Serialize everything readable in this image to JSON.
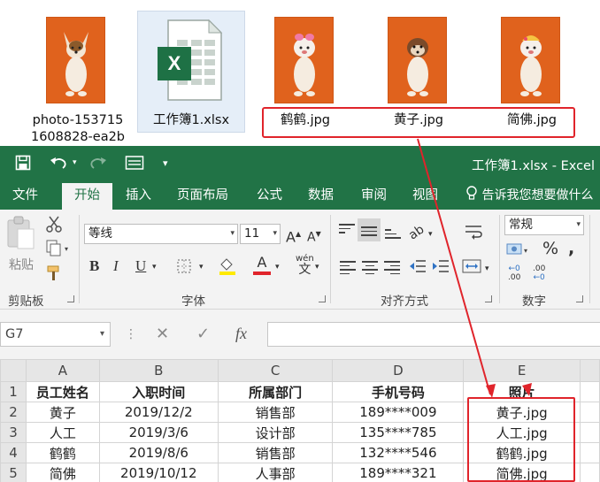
{
  "explorer": {
    "files": [
      {
        "name": "photo-153715\n1608828-ea2b",
        "kind": "photo"
      },
      {
        "name": "工作簿1.xlsx",
        "kind": "excel"
      },
      {
        "name": "鹤鹤.jpg",
        "kind": "photo"
      },
      {
        "name": "黄子.jpg",
        "kind": "photo"
      },
      {
        "name": "简佛.jpg",
        "kind": "photo"
      }
    ],
    "highlight_color": "#e0242b"
  },
  "titlebar": {
    "title": "工作簿1.xlsx - Excel",
    "color": "#217346"
  },
  "ribbon": {
    "tabs": [
      "文件",
      "开始",
      "插入",
      "页面布局",
      "公式",
      "数据",
      "审阅",
      "视图"
    ],
    "active_tab": "开始",
    "tellme": "告诉我您想要做什么",
    "clipboard": {
      "paste": "粘贴",
      "label": "剪贴板"
    },
    "font": {
      "name": "等线",
      "size": "11",
      "label": "字体",
      "bold": "B",
      "italic": "I",
      "underline": "U",
      "grow": "A",
      "shrink": "A",
      "font_color": "A",
      "phonetic": "wén",
      "phonetic_char": "文"
    },
    "alignment": {
      "label": "对齐方式"
    },
    "number": {
      "format": "常规",
      "label": "数字",
      "percent": "%",
      "comma": ",",
      "inc": ".00",
      "dec": "←0",
      "inc2": "←0",
      "dec2": ".00"
    }
  },
  "formula_bar": {
    "namebox": "G7",
    "cancel": "✕",
    "enter": "✓",
    "fx": "fx",
    "value": ""
  },
  "sheet": {
    "columns": [
      "A",
      "B",
      "C",
      "D",
      "E"
    ],
    "rows": [
      {
        "n": "1",
        "cells": [
          "员工姓名",
          "入职时间",
          "所属部门",
          "手机号码",
          "照片"
        ]
      },
      {
        "n": "2",
        "cells": [
          "黄子",
          "2019/12/2",
          "销售部",
          "189****009",
          "黄子.jpg"
        ]
      },
      {
        "n": "3",
        "cells": [
          "人工",
          "2019/3/6",
          "设计部",
          "135****785",
          "人工.jpg"
        ]
      },
      {
        "n": "4",
        "cells": [
          "鹤鹤",
          "2019/8/6",
          "销售部",
          "132****546",
          "鹤鹤.jpg"
        ]
      },
      {
        "n": "5",
        "cells": [
          "简佛",
          "2019/10/12",
          "人事部",
          "189****321",
          "简佛.jpg"
        ]
      }
    ]
  }
}
